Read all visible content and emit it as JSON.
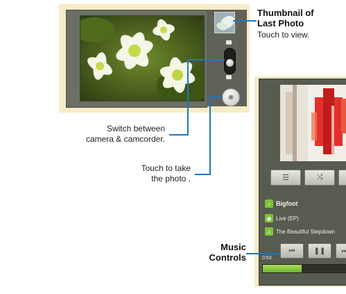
{
  "camera": {
    "callouts": {
      "thumbnail": {
        "title": "Thumbnail of Last Photo",
        "title_line1": "Thumbnail of",
        "title_line2": "Last Photo",
        "hint": "Touch to view."
      },
      "switch": {
        "line1": "Switch between",
        "line2": "camera & camcorder."
      },
      "shutter": {
        "line1": "Touch to take",
        "line2": "the photo ."
      }
    }
  },
  "music": {
    "callout": {
      "line1": "Music",
      "line2": "Controls"
    },
    "track": {
      "title": "Bigfoot",
      "album": "Live (EP)",
      "artist": "The Beautiful Stepdown"
    },
    "elapsed": "0:53",
    "progress_fraction": 0.45,
    "buttons": [
      "list-icon",
      "shuffle-icon",
      "repeat-icon"
    ],
    "transport": [
      "previous-icon",
      "pause-icon",
      "next-icon"
    ]
  },
  "colors": {
    "callout_line": "#1d78c0",
    "device_bg": "#f6ecc6",
    "accent_green": "#7bc23a"
  }
}
